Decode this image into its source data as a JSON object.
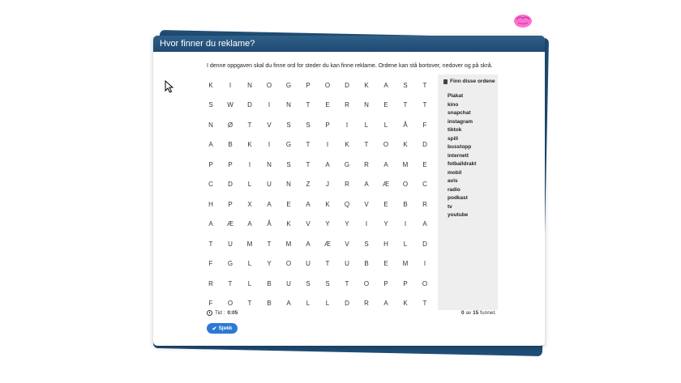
{
  "window": {
    "title": "Hvor finner du reklame?"
  },
  "instructions": "I denne oppgaven skal du finne ord for steder du kan finne reklame. Ordene kan stå bortover, nedover og på skrå.",
  "grid": [
    [
      "K",
      "I",
      "N",
      "O",
      "G",
      "P",
      "O",
      "D",
      "K",
      "A",
      "S",
      "T"
    ],
    [
      "S",
      "W",
      "D",
      "I",
      "N",
      "T",
      "E",
      "R",
      "N",
      "E",
      "T",
      "T"
    ],
    [
      "N",
      "Ø",
      "T",
      "V",
      "S",
      "S",
      "P",
      "I",
      "L",
      "L",
      "Å",
      "F"
    ],
    [
      "A",
      "B",
      "K",
      "I",
      "G",
      "T",
      "I",
      "K",
      "T",
      "O",
      "K",
      "D"
    ],
    [
      "P",
      "P",
      "I",
      "N",
      "S",
      "T",
      "A",
      "G",
      "R",
      "A",
      "M",
      "E"
    ],
    [
      "C",
      "D",
      "L",
      "U",
      "N",
      "Z",
      "J",
      "R",
      "A",
      "Æ",
      "O",
      "C"
    ],
    [
      "H",
      "P",
      "X",
      "A",
      "E",
      "A",
      "K",
      "Q",
      "V",
      "E",
      "B",
      "R"
    ],
    [
      "A",
      "Æ",
      "A",
      "Å",
      "K",
      "V",
      "Y",
      "Y",
      "I",
      "Y",
      "I",
      "A"
    ],
    [
      "T",
      "U",
      "M",
      "T",
      "M",
      "A",
      "Æ",
      "V",
      "S",
      "H",
      "L",
      "D"
    ],
    [
      "F",
      "G",
      "L",
      "Y",
      "O",
      "U",
      "T",
      "U",
      "B",
      "E",
      "M",
      "I"
    ],
    [
      "R",
      "T",
      "L",
      "B",
      "U",
      "S",
      "S",
      "T",
      "O",
      "P",
      "P",
      "O"
    ],
    [
      "F",
      "O",
      "T",
      "B",
      "A",
      "L",
      "L",
      "D",
      "R",
      "A",
      "K",
      "T"
    ]
  ],
  "word_panel": {
    "title": "Finn disse ordene",
    "icon": "book-icon",
    "words": [
      "Plakat",
      "kino",
      "snapchat",
      "instagram",
      "tiktok",
      "spill",
      "busstopp",
      "internett",
      "fotballdrakt",
      "mobil",
      "avis",
      "radio",
      "podkast",
      "tv",
      "youtube"
    ]
  },
  "timer": {
    "label": "Tid :",
    "value": "0:05",
    "icon": "clock-icon"
  },
  "progress": {
    "found": "0",
    "separator": "av",
    "total": "15",
    "suffix": "funnet."
  },
  "check_button": {
    "label": "Sjekk",
    "icon": "check-icon"
  },
  "colors": {
    "header": "#2f5f87",
    "accent": "#2a7ad5",
    "panel": "#eeeeee",
    "card_edge": "#1f4d75"
  }
}
